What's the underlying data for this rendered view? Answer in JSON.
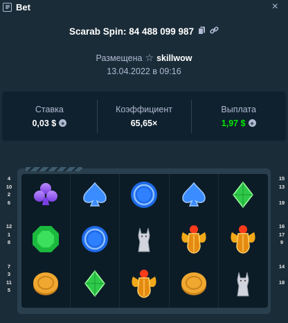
{
  "header": {
    "title": "Bet",
    "icon": "receipt-icon",
    "close": "×"
  },
  "spin": {
    "text": "Scarab Spin: 84 488 099 987"
  },
  "placed": {
    "prefix": "Размещена",
    "user": "skillwow"
  },
  "date": "13.04.2022 в 09:16",
  "stats": [
    {
      "label": "Ставка",
      "value": "0,03 $",
      "coin": true,
      "green": false
    },
    {
      "label": "Коэффициент",
      "value": "65,65×",
      "coin": false,
      "green": false
    },
    {
      "label": "Выплата",
      "value": "1,97 $",
      "coin": true,
      "green": true
    }
  ],
  "paylines_left": [
    "4",
    "10",
    "2",
    "6",
    "",
    "",
    "12",
    "1",
    "8",
    "",
    "",
    "7",
    "3",
    "11",
    "5"
  ],
  "paylines_right": [
    "15",
    "13",
    "",
    "19",
    "",
    "",
    "16",
    "17",
    "9",
    "",
    "",
    "14",
    "",
    "18",
    ""
  ],
  "reels": [
    "club-icon",
    "spade-icon",
    "blue-orb-icon",
    "spade-icon",
    "green-diamond-icon",
    "emerald-icon",
    "blue-orb-icon",
    "cat-statue-icon",
    "scarab-icon",
    "scarab-icon",
    "gold-coin-icon",
    "green-diamond-icon",
    "scarab-icon",
    "gold-coin-icon",
    "cat-statue-icon"
  ],
  "colors": {
    "bg": "#1a2c38",
    "panel": "#0f212e",
    "muted": "#b1bad3",
    "green": "#00e701"
  }
}
